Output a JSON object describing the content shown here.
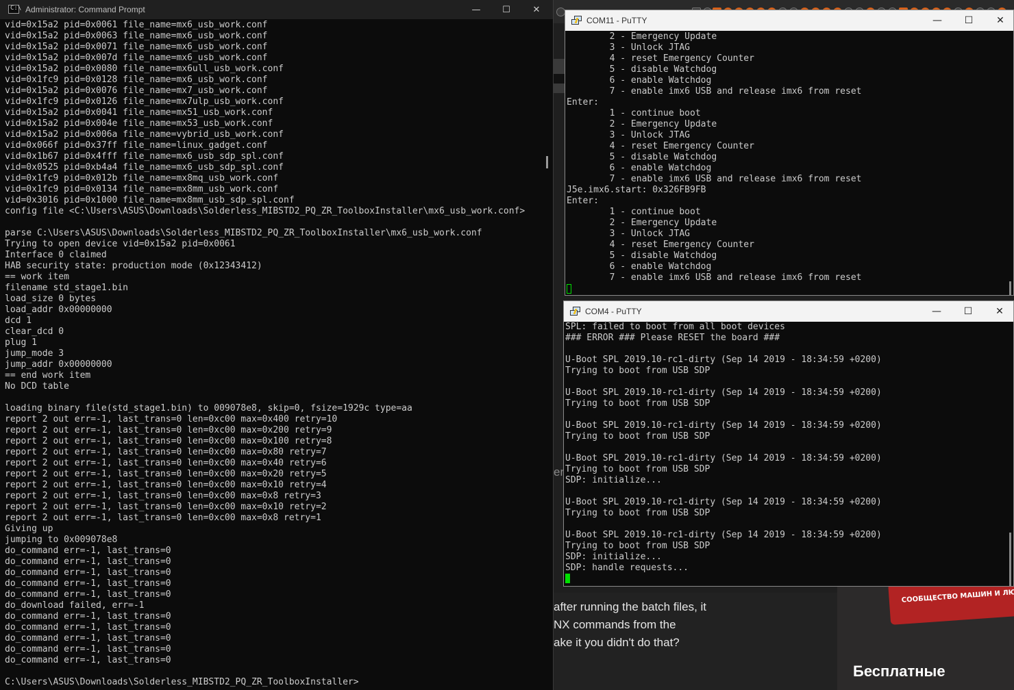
{
  "background_browser": {
    "partial_letter": "er",
    "forum_text": [
      "after running the batch files, it",
      "NX commands from the",
      "ake it you didn't do that?"
    ],
    "ad_banner_text": "СООБЩЕСТВО МАШИН И ЛЮДЕЙ",
    "ad_title": "Бесплатные"
  },
  "cmd": {
    "title": "Administrator: Command Prompt",
    "icon": "cmd-prompt-icon",
    "controls": {
      "minimize": "—",
      "maximize": "☐",
      "close": "✕"
    },
    "output": "vid=0x15a2 pid=0x0061 file_name=mx6_usb_work.conf\nvid=0x15a2 pid=0x0063 file_name=mx6_usb_work.conf\nvid=0x15a2 pid=0x0071 file_name=mx6_usb_work.conf\nvid=0x15a2 pid=0x007d file_name=mx6_usb_work.conf\nvid=0x15a2 pid=0x0080 file_name=mx6ull_usb_work.conf\nvid=0x1fc9 pid=0x0128 file_name=mx6_usb_work.conf\nvid=0x15a2 pid=0x0076 file_name=mx7_usb_work.conf\nvid=0x1fc9 pid=0x0126 file_name=mx7ulp_usb_work.conf\nvid=0x15a2 pid=0x0041 file_name=mx51_usb_work.conf\nvid=0x15a2 pid=0x004e file_name=mx53_usb_work.conf\nvid=0x15a2 pid=0x006a file_name=vybrid_usb_work.conf\nvid=0x066f pid=0x37ff file_name=linux_gadget.conf\nvid=0x1b67 pid=0x4fff file_name=mx6_usb_sdp_spl.conf\nvid=0x0525 pid=0xb4a4 file_name=mx6_usb_sdp_spl.conf\nvid=0x1fc9 pid=0x012b file_name=mx8mq_usb_work.conf\nvid=0x1fc9 pid=0x0134 file_name=mx8mm_usb_work.conf\nvid=0x3016 pid=0x1000 file_name=mx8mm_usb_sdp_spl.conf\nconfig file <C:\\Users\\ASUS\\Downloads\\Solderless_MIBSTD2_PQ_ZR_ToolboxInstaller\\mx6_usb_work.conf>\n\nparse C:\\Users\\ASUS\\Downloads\\Solderless_MIBSTD2_PQ_ZR_ToolboxInstaller\\mx6_usb_work.conf\nTrying to open device vid=0x15a2 pid=0x0061\nInterface 0 claimed\nHAB security state: production mode (0x12343412)\n== work item\nfilename std_stage1.bin\nload_size 0 bytes\nload_addr 0x00000000\ndcd 1\nclear_dcd 0\nplug 1\njump_mode 3\njump_addr 0x00000000\n== end work item\nNo DCD table\n\nloading binary file(std_stage1.bin) to 009078e8, skip=0, fsize=1929c type=aa\nreport 2 out err=-1, last_trans=0 len=0xc00 max=0x400 retry=10\nreport 2 out err=-1, last_trans=0 len=0xc00 max=0x200 retry=9\nreport 2 out err=-1, last_trans=0 len=0xc00 max=0x100 retry=8\nreport 2 out err=-1, last_trans=0 len=0xc00 max=0x80 retry=7\nreport 2 out err=-1, last_trans=0 len=0xc00 max=0x40 retry=6\nreport 2 out err=-1, last_trans=0 len=0xc00 max=0x20 retry=5\nreport 2 out err=-1, last_trans=0 len=0xc00 max=0x10 retry=4\nreport 2 out err=-1, last_trans=0 len=0xc00 max=0x8 retry=3\nreport 2 out err=-1, last_trans=0 len=0xc00 max=0x10 retry=2\nreport 2 out err=-1, last_trans=0 len=0xc00 max=0x8 retry=1\nGiving up\njumping to 0x009078e8\ndo_command err=-1, last_trans=0\ndo_command err=-1, last_trans=0\ndo_command err=-1, last_trans=0\ndo_command err=-1, last_trans=0\ndo_command err=-1, last_trans=0\ndo_download failed, err=-1\ndo_command err=-1, last_trans=0\ndo_command err=-1, last_trans=0\ndo_command err=-1, last_trans=0\ndo_command err=-1, last_trans=0\ndo_command err=-1, last_trans=0\n\nC:\\Users\\ASUS\\Downloads\\Solderless_MIBSTD2_PQ_ZR_ToolboxInstaller>"
  },
  "com11": {
    "title": "COM11 - PuTTY",
    "icon": "putty-icon",
    "controls": {
      "minimize": "—",
      "maximize": "☐",
      "close": "✕"
    },
    "output": "        2 - Emergency Update\n        3 - Unlock JTAG\n        4 - reset Emergency Counter\n        5 - disable Watchdog\n        6 - enable Watchdog\n        7 - enable imx6 USB and release imx6 from reset\nEnter:\n        1 - continue boot\n        2 - Emergency Update\n        3 - Unlock JTAG\n        4 - reset Emergency Counter\n        5 - disable Watchdog\n        6 - enable Watchdog\n        7 - enable imx6 USB and release imx6 from reset\nJ5e.imx6.start: 0x326FB9FB\nEnter:\n        1 - continue boot\n        2 - Emergency Update\n        3 - Unlock JTAG\n        4 - reset Emergency Counter\n        5 - disable Watchdog\n        6 - enable Watchdog\n        7 - enable imx6 USB and release imx6 from reset",
    "cursor_color": "#00e000"
  },
  "com4": {
    "title": "COM4 - PuTTY",
    "icon": "putty-icon",
    "controls": {
      "minimize": "—",
      "maximize": "☐",
      "close": "✕"
    },
    "output": "SPL: failed to boot from all boot devices\n### ERROR ### Please RESET the board ###\n\nU-Boot SPL 2019.10-rc1-dirty (Sep 14 2019 - 18:34:59 +0200)\nTrying to boot from USB SDP\n\nU-Boot SPL 2019.10-rc1-dirty (Sep 14 2019 - 18:34:59 +0200)\nTrying to boot from USB SDP\n\nU-Boot SPL 2019.10-rc1-dirty (Sep 14 2019 - 18:34:59 +0200)\nTrying to boot from USB SDP\n\nU-Boot SPL 2019.10-rc1-dirty (Sep 14 2019 - 18:34:59 +0200)\nTrying to boot from USB SDP\nSDP: initialize...\n\nU-Boot SPL 2019.10-rc1-dirty (Sep 14 2019 - 18:34:59 +0200)\nTrying to boot from USB SDP\n\nU-Boot SPL 2019.10-rc1-dirty (Sep 14 2019 - 18:34:59 +0200)\nTrying to boot from USB SDP\nSDP: initialize...\nSDP: handle requests...",
    "cursor_color": "#00e000"
  }
}
